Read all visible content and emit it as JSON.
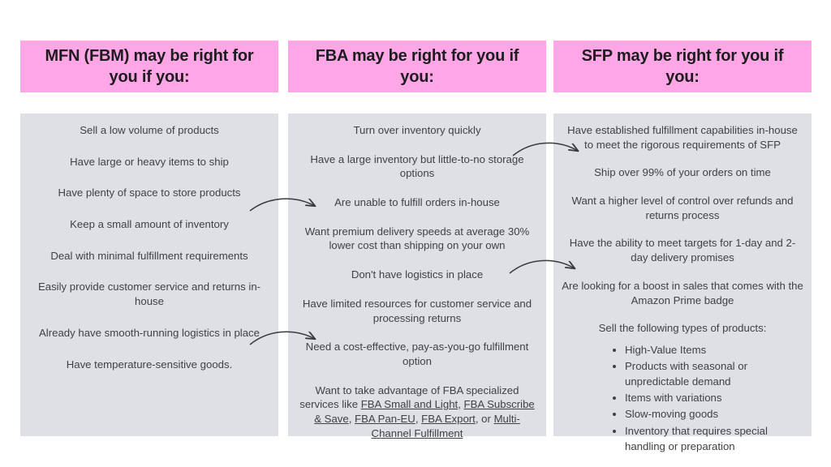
{
  "theme": {
    "header_bg": "#ffa6e6",
    "panel_bg": "#dee0e5",
    "text_color": "#3f4145",
    "header_text_color": "#1d1d1f",
    "arrow_color": "#3a3a3c",
    "page_bg": "#ffffff"
  },
  "columns": [
    {
      "id": "mfn",
      "header": "MFN (FBM) may be right for you if you:",
      "items": [
        "Sell a low volume of products",
        "Have large or heavy items to ship",
        "Have plenty of space to store products",
        "Keep a small amount of inventory",
        "Deal with minimal fulfillment requirements",
        "Easily provide customer service and returns in-house",
        "Already have smooth-running logistics in place",
        "Have temperature-sensitive goods."
      ]
    },
    {
      "id": "fba",
      "header": "FBA may be right for you if you:",
      "items": [
        "Turn over inventory quickly",
        "Have a large inventory but little-to-no storage options",
        "Are unable to fulfill orders in-house",
        "Want premium delivery speeds at average 30% lower cost than shipping on your own",
        "Don't have logistics in place",
        "Have limited resources for customer service and processing returns",
        "Need a cost-effective, pay-as-you-go fulfillment option"
      ],
      "links_item": {
        "prefix": "Want to take advantage of FBA specialized services like ",
        "links": [
          "FBA Small and Light",
          "FBA Subscribe & Save",
          "FBA Pan-EU",
          "FBA Export",
          "Multi-Channel Fulfillment"
        ],
        "separator": ", ",
        "last_separator": " or "
      }
    },
    {
      "id": "sfp",
      "header": "SFP may be right for you if you:",
      "items": [
        "Have established fulfillment capabilities in-house to meet the rigorous requirements of SFP",
        "Ship over 99% of your orders on time",
        "Want a higher level of control over refunds and returns process",
        "Have the ability to meet targets for 1-day and 2-day delivery promises",
        "Are looking for a boost in sales that comes with the Amazon Prime badge"
      ],
      "product_types": {
        "lead_in": "Sell the following types of products:",
        "bullets": [
          "High-Value Items",
          "Products with seasonal or unpredictable demand",
          "Items with variations",
          "Slow-moving goods",
          "Inventory that requires special handling or preparation"
        ]
      }
    }
  ],
  "arrows": [
    {
      "name": "arrow-mfn-to-fba-upper",
      "from_column": "mfn",
      "to_column": "fba"
    },
    {
      "name": "arrow-mfn-to-fba-lower",
      "from_column": "mfn",
      "to_column": "fba"
    },
    {
      "name": "arrow-fba-to-sfp-upper",
      "from_column": "fba",
      "to_column": "sfp"
    },
    {
      "name": "arrow-fba-to-sfp-lower",
      "from_column": "fba",
      "to_column": "sfp"
    }
  ]
}
